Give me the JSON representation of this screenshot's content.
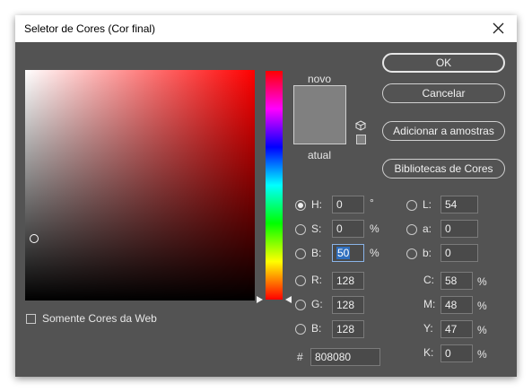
{
  "window": {
    "title": "Seletor de Cores (Cor final)"
  },
  "icons": {
    "close": "close-icon",
    "cube": "cube-icon",
    "radio_selected": "radio-selected-icon"
  },
  "preview": {
    "new_label": "novo",
    "current_label": "atual",
    "new_color": "#808080",
    "current_color": "#808080"
  },
  "buttons": {
    "ok": "OK",
    "cancel": "Cancelar",
    "add_to_swatches": "Adicionar a amostras",
    "color_libraries": "Bibliotecas de Cores"
  },
  "fields": {
    "H": {
      "label": "H:",
      "value": "0",
      "unit": "°"
    },
    "S": {
      "label": "S:",
      "value": "0",
      "unit": "%"
    },
    "B": {
      "label": "B:",
      "value": "50",
      "unit": "%"
    },
    "R": {
      "label": "R:",
      "value": "128"
    },
    "G": {
      "label": "G:",
      "value": "128"
    },
    "Bb": {
      "label": "B:",
      "value": "128"
    },
    "L": {
      "label": "L:",
      "value": "54"
    },
    "a": {
      "label": "a:",
      "value": "0"
    },
    "b": {
      "label": "b:",
      "value": "0"
    },
    "C": {
      "label": "C:",
      "value": "58",
      "unit": "%"
    },
    "M": {
      "label": "M:",
      "value": "48",
      "unit": "%"
    },
    "Y": {
      "label": "Y:",
      "value": "47",
      "unit": "%"
    },
    "K": {
      "label": "K:",
      "value": "0",
      "unit": "%"
    },
    "hex": {
      "label": "#",
      "value": "808080"
    }
  },
  "selected_mode": "H",
  "web_only": {
    "label": "Somente Cores da Web",
    "checked": false
  },
  "colors": {
    "dialog_bg": "#535353",
    "title_bg": "#ffffff",
    "hue": "#ff0000",
    "selection": "#2f6fbf"
  }
}
